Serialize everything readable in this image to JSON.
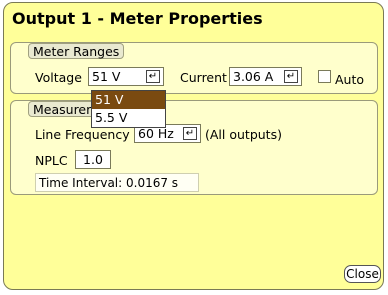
{
  "window": {
    "title": "Output 1 - Meter Properties"
  },
  "meter_ranges": {
    "legend": "Meter Ranges",
    "voltage_label": "Voltage",
    "voltage_value": "51 V",
    "current_label": "Current",
    "current_value": "3.06 A",
    "auto_label": "Auto",
    "auto_checked": false
  },
  "voltage_dropdown": {
    "options": [
      "51 V",
      "5.5 V"
    ],
    "selected": "51 V"
  },
  "measurement": {
    "legend": "Measuremen",
    "line_frequency_label": "Line Frequency",
    "line_frequency_value": "60 Hz",
    "all_outputs_label": "(All outputs)",
    "nplc_label": "NPLC",
    "nplc_value": "1.0",
    "time_interval_text": "Time Interval: 0.0167 s"
  },
  "buttons": {
    "close_label": "Close"
  },
  "icons": {
    "dropdown_glyph": "↵"
  },
  "colors": {
    "background": "#ffff99",
    "selection": "#7a4a10"
  }
}
